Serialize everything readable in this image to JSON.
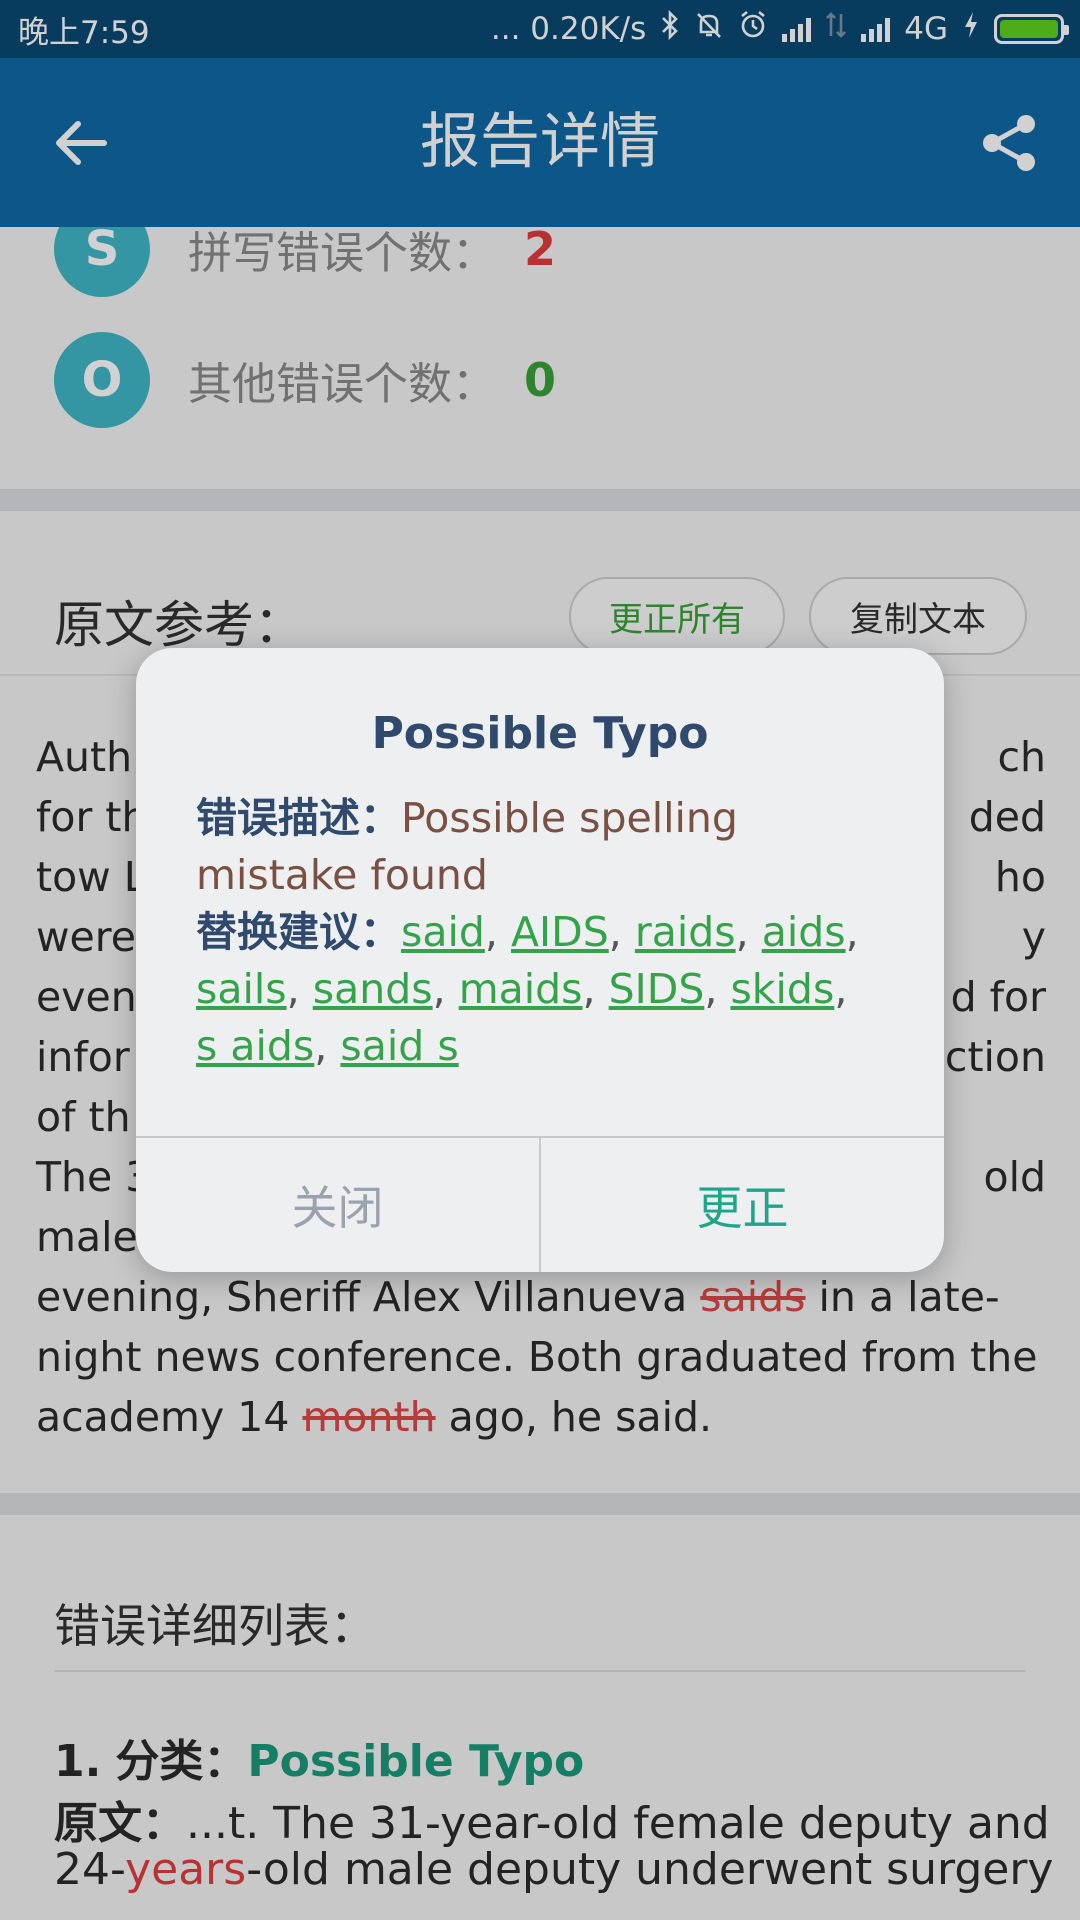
{
  "status_bar": {
    "time": "晚上7:59",
    "network_speed": "... 0.20K/s",
    "network_type": "4G",
    "icons": [
      "bluetooth-icon",
      "mute-icon",
      "alarm-icon",
      "signal-icon",
      "data-icon",
      "signal-icon",
      "charging-icon",
      "battery-icon"
    ],
    "battery_color": "#5fd21f"
  },
  "app_bar": {
    "title": "报告详情",
    "back_icon": "arrow-left-icon",
    "share_icon": "share-icon",
    "color": "#0f6aa6"
  },
  "stats": [
    {
      "letter": "S",
      "label": "拼写错误个数：",
      "value": "2"
    },
    {
      "letter": "O",
      "label": "其他错误个数：",
      "value": "0"
    }
  ],
  "original": {
    "heading": "原文参考：",
    "fix_all": "更正所有",
    "copy_text": "复制文本",
    "left_lines": [
      "Auth",
      "for th",
      "tow L",
      "were",
      "even",
      "infor",
      "of th"
    ],
    "right_lines": [
      "ch",
      "ded",
      "ho",
      "y",
      "d for",
      "ction"
    ],
    "line8_left": "The 3",
    "line8_right": "old",
    "line9_left": "male",
    "line10_before": "evening, Sheriff Alex Villanueva ",
    "line10_error": "saids",
    "line10_after": " in a late-",
    "line11": "night news conference. Both graduated from the",
    "line12_before": "academy 14 ",
    "line12_error": "month",
    "line12_after": " ago, he said."
  },
  "error_list": {
    "heading": "错误详细列表：",
    "item_number": "1.",
    "category_label": "分类：",
    "category_value": "Possible Typo",
    "original_label": "原文：",
    "original_text": "...t. The 31-year-old female deputy and",
    "line2_before": "24-",
    "line2_error": "years",
    "line2_after": "-old male deputy underwent surgery"
  },
  "dialog": {
    "title": "Possible Typo",
    "desc_label": "错误描述：",
    "desc_text_1": "Possible spelling",
    "desc_text_2": "mistake found",
    "sugg_label": "替换建议：",
    "suggestions": [
      "said",
      "AIDS",
      "raids",
      "aids",
      "sails",
      "sands",
      "maids",
      "SIDS",
      "skids",
      "s aids",
      "said s"
    ],
    "comma": ",",
    "close_label": "关闭",
    "confirm_label": "更正"
  }
}
